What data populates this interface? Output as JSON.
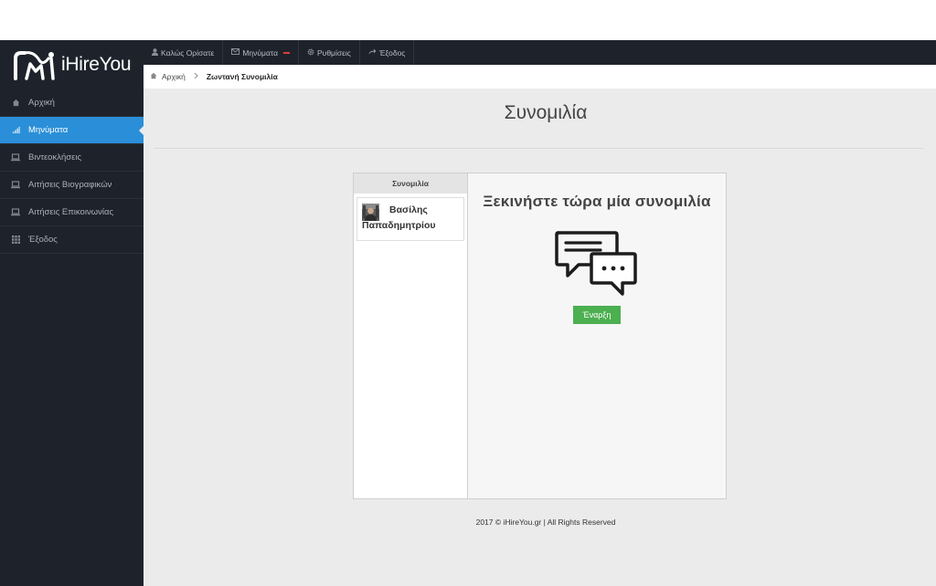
{
  "brand": {
    "name": "iHireYou"
  },
  "topbar": {
    "items": [
      {
        "label": "Καλώς Ορίσατε",
        "icon": "user-icon"
      },
      {
        "label": "Μηνύματα",
        "icon": "envelope-icon"
      },
      {
        "label": "Ρυθμίσεις",
        "icon": "gear-icon"
      },
      {
        "label": "Έξοδος",
        "icon": "share-icon"
      }
    ]
  },
  "breadcrumb": {
    "home": "Αρχική",
    "current": "Ζωντανή Συνομιλία"
  },
  "sidebar": {
    "items": [
      {
        "label": "Αρχική",
        "icon": "home-icon",
        "active": false
      },
      {
        "label": "Μηνύματα",
        "icon": "signal-icon",
        "active": true
      },
      {
        "label": "Βιντεοκλήσεις",
        "icon": "laptop-icon",
        "active": false
      },
      {
        "label": "Αιτήσεις Βιογραφικών",
        "icon": "laptop-icon",
        "active": false
      },
      {
        "label": "Αιτήσεις Επικοινωνίας",
        "icon": "laptop-icon",
        "active": false
      },
      {
        "label": "Έξοδος",
        "icon": "grid-icon",
        "active": false
      }
    ]
  },
  "page": {
    "title": "Συνομιλία"
  },
  "chat": {
    "list_header": "Συνομιλία",
    "contacts": [
      {
        "name": "Βασίλης Παπαδημητρίου"
      }
    ],
    "heading": "Ξεκινήστε τώρα μία συνομιλία",
    "start_button": "Έναρξη"
  },
  "footer": {
    "text": "2017 © iHireYou.gr | All Rights Reserved"
  },
  "colors": {
    "accent": "#2a8fd8",
    "sidebar": "#1e232b",
    "start_button": "#4caf50",
    "badge": "#e23c3c"
  }
}
